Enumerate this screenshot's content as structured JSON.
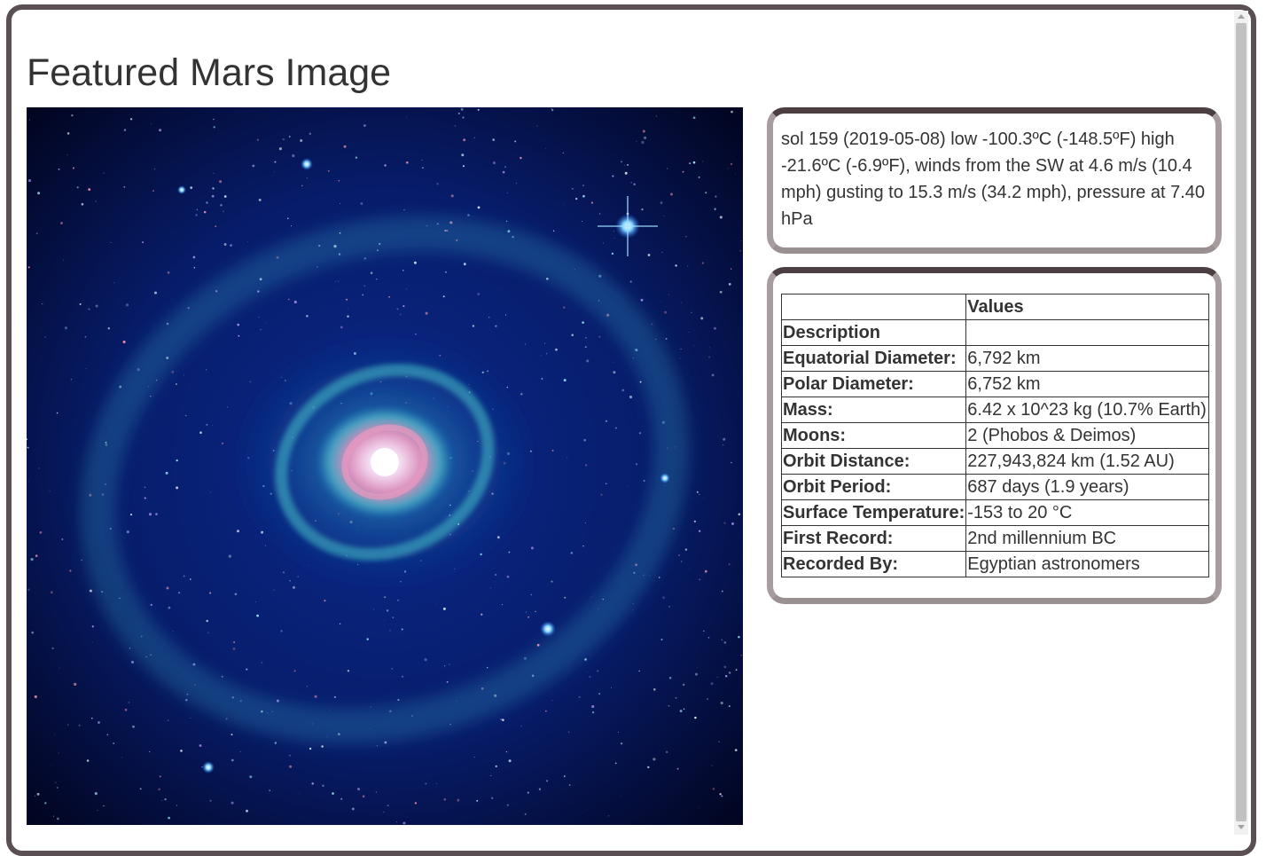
{
  "page": {
    "title": "Featured Mars Image"
  },
  "weather": {
    "text": "sol 159 (2019-05-08) low -100.3ºC (-148.5ºF) high -21.6ºC (-6.9ºF), winds from the SW at 4.6 m/s (10.4 mph) gusting to 15.3 m/s (34.2 mph), pressure at 7.40 hPa"
  },
  "facts": {
    "header_key": "",
    "header_value": "Values",
    "rows": [
      {
        "label": "Description",
        "value": ""
      },
      {
        "label": "Equatorial Diameter:",
        "value": "6,792 km"
      },
      {
        "label": "Polar Diameter:",
        "value": "6,752 km"
      },
      {
        "label": "Mass:",
        "value": "6.42 x 10^23 kg (10.7% Earth)"
      },
      {
        "label": "Moons:",
        "value": "2 (Phobos & Deimos)"
      },
      {
        "label": "Orbit Distance:",
        "value": "227,943,824 km (1.52 AU)"
      },
      {
        "label": "Orbit Period:",
        "value": "687 days (1.9 years)"
      },
      {
        "label": "Surface Temperature:",
        "value": "-153 to 20 °C"
      },
      {
        "label": "First Record:",
        "value": "2nd millennium BC"
      },
      {
        "label": "Recorded By:",
        "value": "Egyptian astronomers"
      }
    ]
  },
  "colors": {
    "frame": "#5a4f52",
    "card_border": "#a79c9e",
    "text": "#333333"
  }
}
